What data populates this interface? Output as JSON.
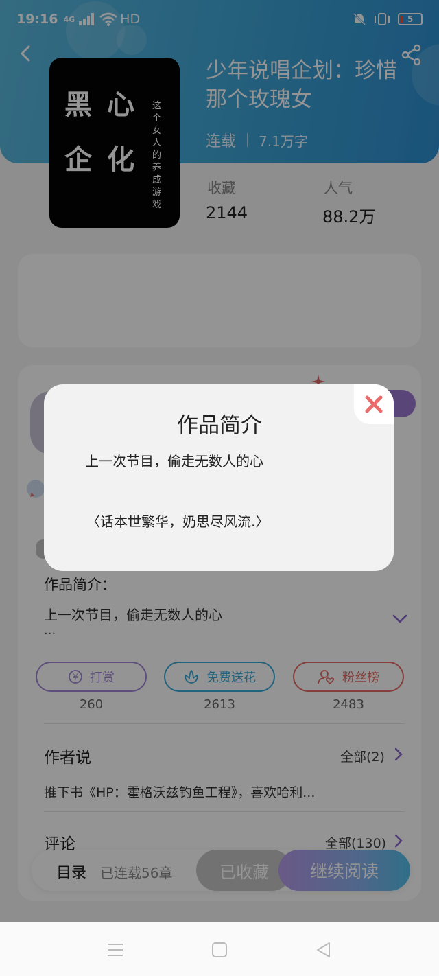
{
  "status_bar": {
    "time": "19:16",
    "signal_label": "4G",
    "network": "HD",
    "battery": "5"
  },
  "book": {
    "title": "少年说唱企划：珍惜那个玫瑰女",
    "status": "连载",
    "word_count": "7.1万字",
    "cover": {
      "big_text": [
        "黑",
        "心",
        "企",
        "化"
      ],
      "side_text": "这个女人的养成游戏"
    }
  },
  "stats": [
    {
      "label": "收藏",
      "value": "2144"
    },
    {
      "label": "人气",
      "value": "88.2万"
    }
  ],
  "intro": {
    "title": "作品简介：",
    "text": "上一次节目，偷走无数人的心",
    "more": "..."
  },
  "actions": [
    {
      "label": "打赏",
      "count": "260",
      "color": "#a186d6",
      "icon": "coin-icon"
    },
    {
      "label": "免费送花",
      "count": "2613",
      "color": "#3aaad6",
      "icon": "flower-icon"
    },
    {
      "label": "粉丝榜",
      "count": "2483",
      "color": "#e36a66",
      "icon": "fan-heart-icon"
    }
  ],
  "author_says": {
    "title": "作者说",
    "link": "全部(2)",
    "text": "推下书《HP：霍格沃兹钓鱼工程》，喜欢哈利..."
  },
  "comments": {
    "title": "评论",
    "link": "全部(130)"
  },
  "bottom_bar": {
    "toc": "目录",
    "chapters": "已连载56章",
    "favorited": "已收藏",
    "continue": "继续阅读"
  },
  "modal": {
    "title": "作品简介",
    "line1": "上一次节目，偷走无数人的心",
    "line2": "〈话本世繁华，奶思尽风流.〉"
  },
  "colors": {
    "header_start": "#5ab9de",
    "header_end": "#2e8fd0",
    "close_icon": "#ea6b6b",
    "read_gradient_start": "#b79ae8",
    "read_gradient_end": "#52bfe9"
  }
}
